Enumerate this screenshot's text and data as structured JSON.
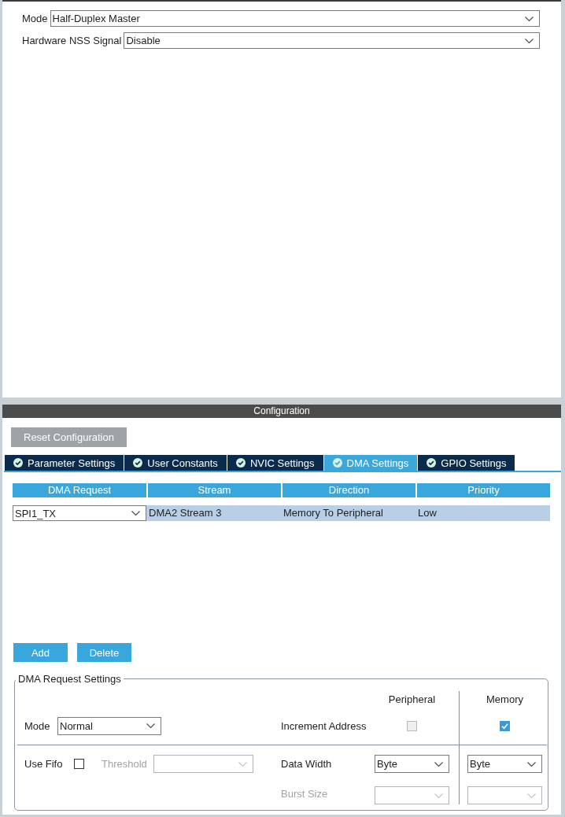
{
  "mode_panel": {
    "rows": [
      {
        "label": "Mode",
        "value": "Half-Duplex Master"
      },
      {
        "label": "Hardware NSS Signal",
        "value": "Disable"
      }
    ]
  },
  "configuration": {
    "title": "Configuration",
    "reset_button": "Reset Configuration",
    "tabs": [
      {
        "label": "Parameter Settings",
        "selected": false
      },
      {
        "label": "User Constants",
        "selected": false
      },
      {
        "label": "NVIC Settings",
        "selected": false
      },
      {
        "label": "DMA Settings",
        "selected": true
      },
      {
        "label": "GPIO Settings",
        "selected": false
      }
    ],
    "dma_table": {
      "columns": [
        "DMA Request",
        "Stream",
        "Direction",
        "Priority"
      ],
      "rows": [
        {
          "request": "SPI1_TX",
          "stream": "DMA2 Stream 3",
          "direction": "Memory To Peripheral",
          "priority": "Low",
          "selected": true
        }
      ]
    },
    "buttons": [
      "Add",
      "Delete"
    ],
    "request_settings": {
      "title": "DMA Request Settings",
      "column_headers": [
        "Peripheral",
        "Memory"
      ],
      "mode": {
        "label": "Mode",
        "value": "Normal"
      },
      "increment_address": {
        "label": "Increment Address",
        "peripheral": {
          "checked": false,
          "disabled": true
        },
        "memory": {
          "checked": true,
          "disabled": false
        }
      },
      "use_fifo": {
        "label": "Use Fifo",
        "checked": false
      },
      "threshold": {
        "label": "Threshold",
        "disabled": true
      },
      "data_width": {
        "label": "Data Width",
        "peripheral": "Byte",
        "memory": "Byte"
      },
      "burst_size": {
        "label": "Burst Size",
        "disabled": true
      }
    }
  }
}
